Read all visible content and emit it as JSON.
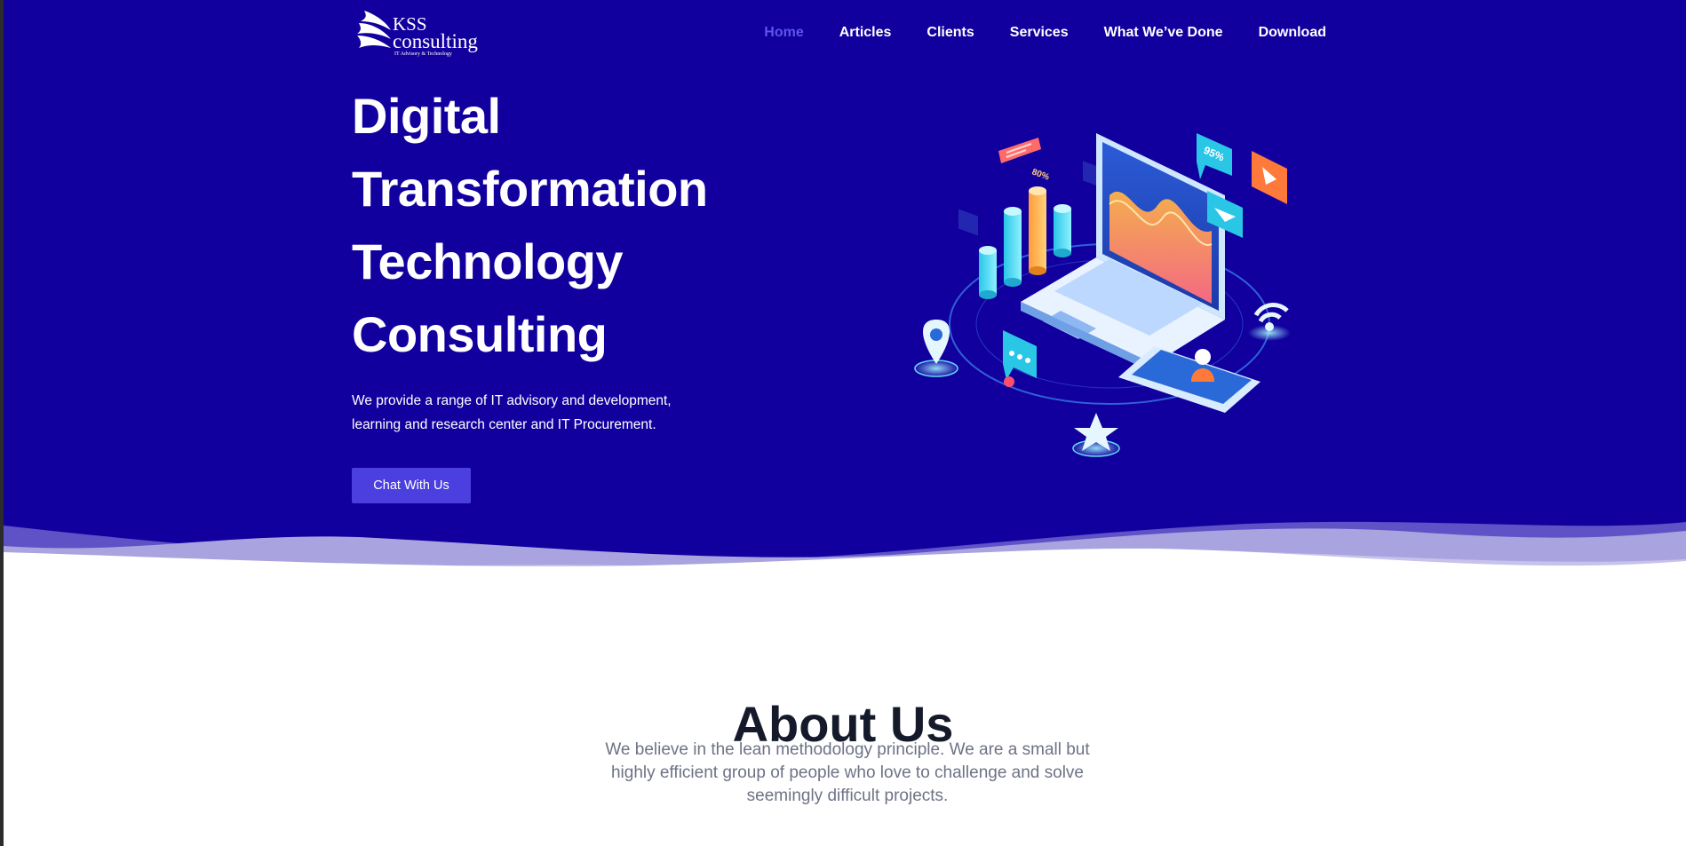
{
  "brand": {
    "name_top": "KSS",
    "name_bottom": "consulting",
    "tagline": "IT Advisory & Technology"
  },
  "nav": {
    "items": [
      {
        "label": "Home",
        "active": true
      },
      {
        "label": "Articles",
        "active": false
      },
      {
        "label": "Clients",
        "active": false
      },
      {
        "label": "Services",
        "active": false
      },
      {
        "label": "What We’ve Done",
        "active": false
      },
      {
        "label": "Download",
        "active": false
      }
    ]
  },
  "hero": {
    "title_lines": [
      "Digital",
      "Transformation",
      "Technology",
      "Consulting"
    ],
    "description_lines": [
      "We provide a range of IT advisory and development,",
      "learning and research center and IT Procurement."
    ],
    "cta_label": "Chat With Us",
    "illustration": {
      "badge_percent": "95%",
      "bar_label": "80%"
    }
  },
  "about": {
    "title": "About Us",
    "text_lines": [
      "We believe in the lean methodology principle. We are a small but",
      "highly efficient group of people who love to challenge and solve",
      "seemingly difficult projects."
    ]
  },
  "colors": {
    "hero_bg": "#12009e",
    "nav_active": "#5b55e9",
    "cta_bg": "#4c3fe0",
    "heading_dark": "#141a2a",
    "body_grey": "#6d7385"
  }
}
